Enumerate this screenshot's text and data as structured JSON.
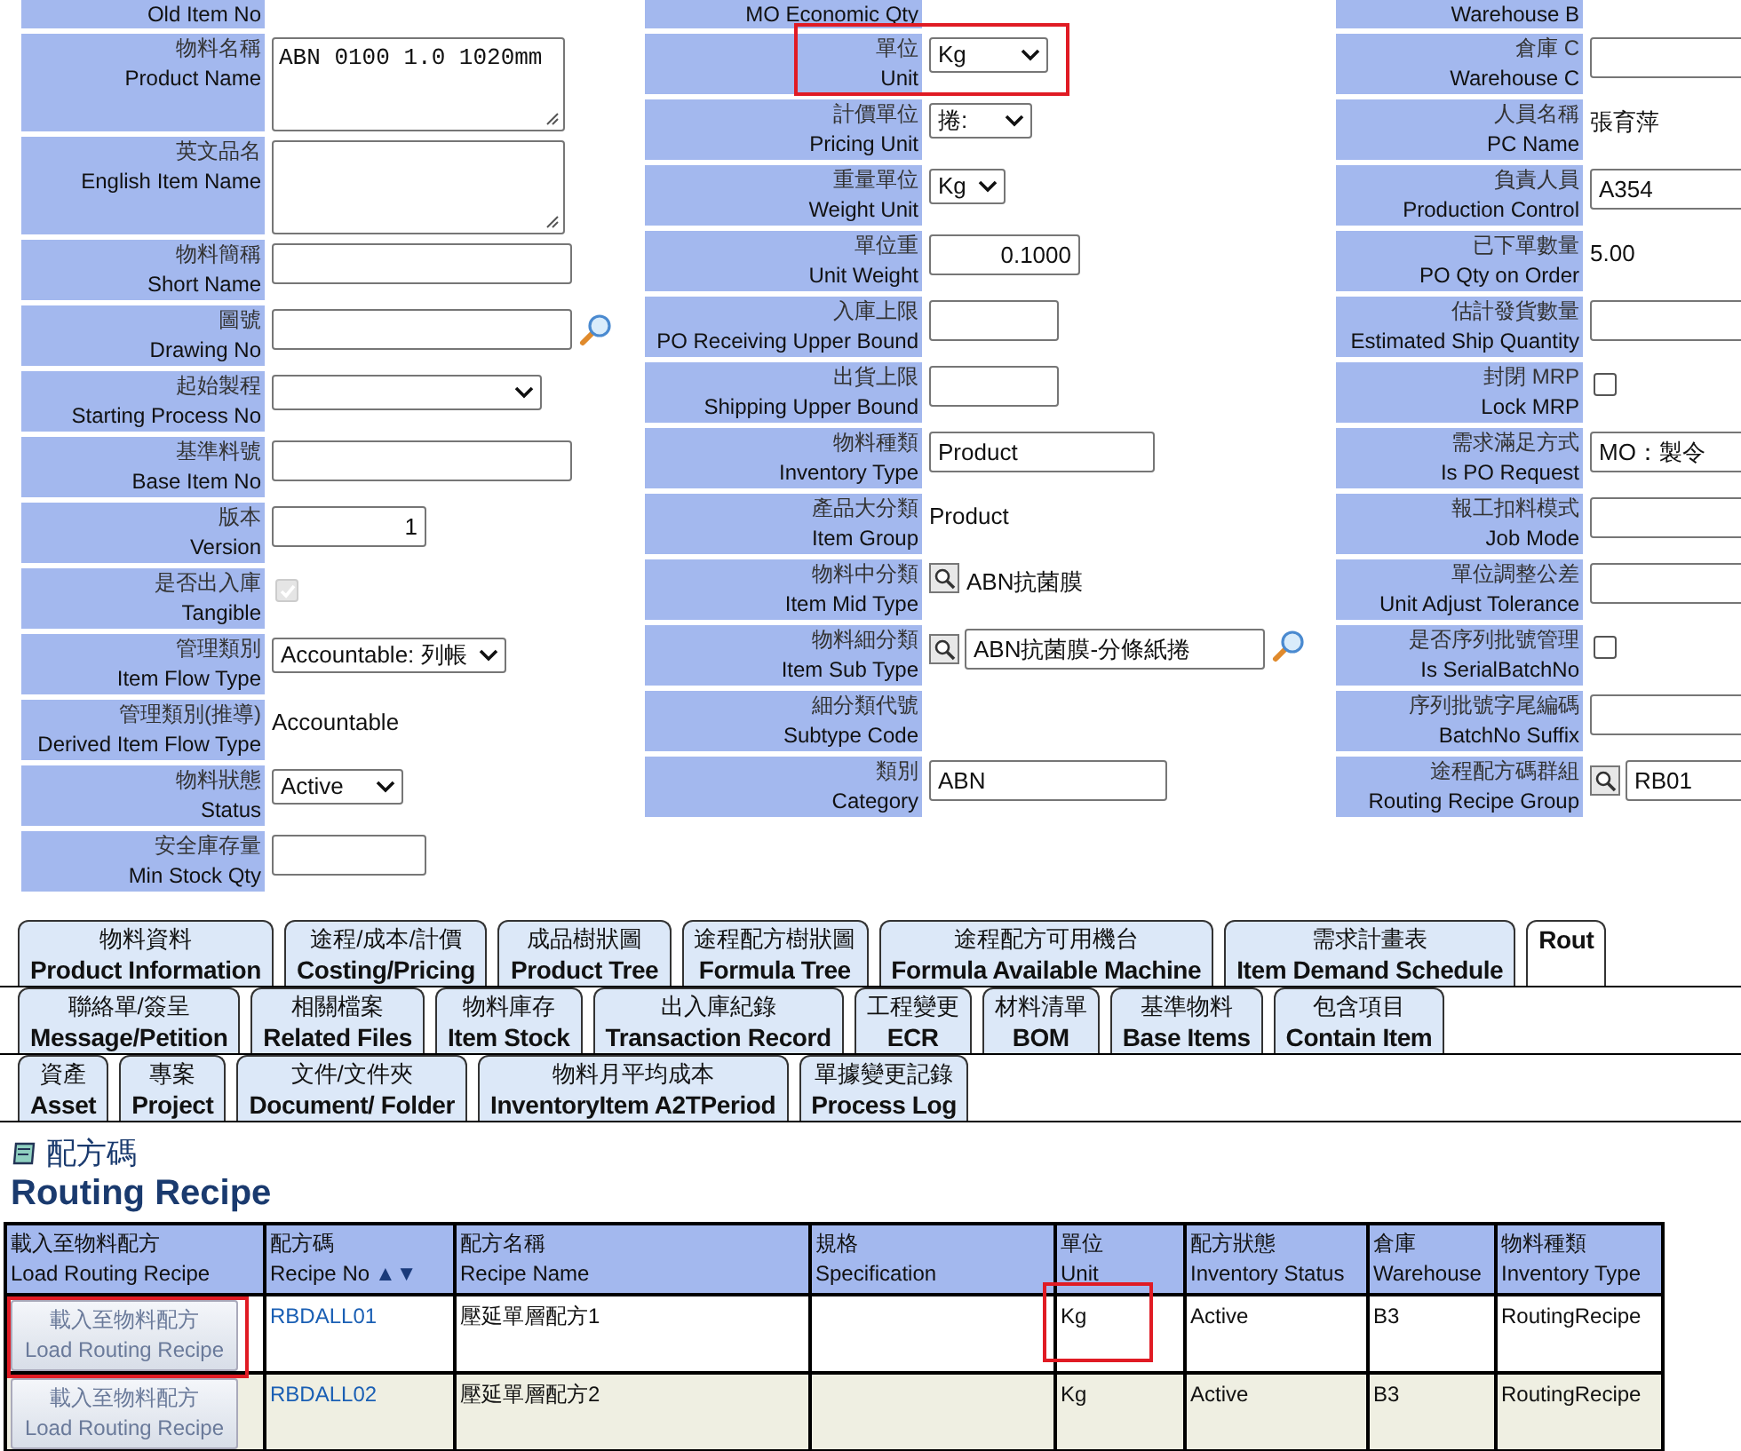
{
  "form_columns": [
    {
      "rows": [
        {
          "en": "Old Item No",
          "highlighted": false,
          "field": {
            "kind": "none"
          }
        },
        {
          "zh": "物料名稱",
          "en": "Product Name",
          "highlighted": false,
          "field": {
            "kind": "textarea",
            "value": "ABN 0100 1.0 1020mm"
          }
        },
        {
          "zh": "英文品名",
          "en": "English Item Name",
          "highlighted": false,
          "field": {
            "kind": "textarea"
          }
        },
        {
          "zh": "物料簡稱",
          "en": "Short Name",
          "highlighted": false,
          "field": {
            "kind": "input"
          }
        },
        {
          "zh": "圖號",
          "en": "Drawing No",
          "highlighted": false,
          "field": {
            "kind": "search_input"
          }
        },
        {
          "zh": "起始製程",
          "en": "Starting Process No",
          "highlighted": false,
          "field": {
            "kind": "select"
          }
        },
        {
          "zh": "基準料號",
          "en": "Base Item No",
          "highlighted": false,
          "field": {
            "kind": "input"
          }
        },
        {
          "zh": "版本",
          "en": "Version",
          "highlighted": false,
          "field": {
            "kind": "input",
            "value": "1"
          }
        },
        {
          "zh": "是否出入庫",
          "en": "Tangible",
          "highlighted": false,
          "field": {
            "kind": "checkbox",
            "checked": true,
            "disabled": true
          }
        },
        {
          "zh": "管理類別",
          "en": "Item Flow Type",
          "highlighted": false,
          "field": {
            "kind": "select",
            "value": "Accountable: 列帳"
          }
        },
        {
          "zh": "管理類別(推導)",
          "en": "Derived Item Flow Type",
          "highlighted": false,
          "field": {
            "kind": "text",
            "value": "Accountable"
          }
        },
        {
          "zh": "物料狀態",
          "en": "Status",
          "highlighted": false,
          "field": {
            "kind": "select",
            "value": "Active"
          }
        },
        {
          "zh": "安全庫存量",
          "en": "Min Stock Qty",
          "highlighted": false,
          "field": {
            "kind": "input"
          }
        }
      ]
    },
    {
      "rows": [
        {
          "en": "MO Economic Qty",
          "highlighted": false,
          "field": {
            "kind": "none"
          }
        },
        {
          "zh": "單位",
          "en": "Unit",
          "highlighted": true,
          "field": {
            "kind": "select",
            "value": "Kg"
          }
        },
        {
          "zh": "計價單位",
          "en": "Pricing Unit",
          "highlighted": false,
          "field": {
            "kind": "select",
            "value": "捲:"
          }
        },
        {
          "zh": "重量單位",
          "en": "Weight Unit",
          "highlighted": false,
          "field": {
            "kind": "select",
            "value": "Kg"
          }
        },
        {
          "zh": "單位重",
          "en": "Unit Weight",
          "highlighted": false,
          "field": {
            "kind": "input",
            "value": "0.1000"
          }
        },
        {
          "zh": "入庫上限",
          "en": "PO Receiving Upper Bound",
          "highlighted": false,
          "field": {
            "kind": "input"
          }
        },
        {
          "zh": "出貨上限",
          "en": "Shipping Upper Bound",
          "highlighted": false,
          "field": {
            "kind": "input"
          }
        },
        {
          "zh": "物料種類",
          "en": "Inventory Type",
          "highlighted": false,
          "field": {
            "kind": "input",
            "value": "Product"
          }
        },
        {
          "zh": "產品大分類",
          "en": "Item Group",
          "highlighted": false,
          "field": {
            "kind": "text",
            "value": "Product"
          }
        },
        {
          "zh": "物料中分類",
          "en": "Item Mid Type",
          "highlighted": false,
          "field": {
            "kind": "lookup_text",
            "value": "ABN抗菌膜"
          }
        },
        {
          "zh": "物料細分類",
          "en": "Item Sub Type",
          "highlighted": false,
          "field": {
            "kind": "lookup_input",
            "value": "ABN抗菌膜-分條紙捲"
          }
        },
        {
          "zh": "細分類代號",
          "en": "Subtype Code",
          "highlighted": false,
          "field": {
            "kind": "none"
          }
        },
        {
          "zh": "類別",
          "en": "Category",
          "highlighted": false,
          "field": {
            "kind": "input",
            "value": "ABN"
          }
        }
      ]
    },
    {
      "rows": [
        {
          "en": "Warehouse B",
          "highlighted": false,
          "field": {
            "kind": "none"
          }
        },
        {
          "zh": "倉庫 C",
          "en": "Warehouse C",
          "highlighted": false,
          "field": {
            "kind": "input"
          }
        },
        {
          "zh": "人員名稱",
          "en": "PC Name",
          "highlighted": false,
          "field": {
            "kind": "text",
            "value": "張育萍"
          }
        },
        {
          "zh": "負責人員",
          "en": "Production Control",
          "highlighted": false,
          "field": {
            "kind": "input",
            "value": "A354"
          }
        },
        {
          "zh": "已下單數量",
          "en": "PO Qty on Order",
          "highlighted": false,
          "field": {
            "kind": "text",
            "value": "5.00"
          }
        },
        {
          "zh": "估計發貨數量",
          "en": "Estimated Ship Quantity",
          "highlighted": false,
          "field": {
            "kind": "input"
          }
        },
        {
          "zh": "封閉 MRP",
          "en": "Lock MRP",
          "highlighted": false,
          "field": {
            "kind": "checkbox",
            "checked": false,
            "disabled": false
          }
        },
        {
          "zh": "需求滿足方式",
          "en": "Is PO Request",
          "highlighted": false,
          "field": {
            "kind": "input",
            "value": "MO：製令"
          }
        },
        {
          "zh": "報工扣料模式",
          "en": "Job Mode",
          "highlighted": false,
          "field": {
            "kind": "input"
          }
        },
        {
          "zh": "單位調整公差",
          "en": "Unit Adjust Tolerance",
          "highlighted": false,
          "field": {
            "kind": "input"
          }
        },
        {
          "zh": "是否序列批號管理",
          "en": "Is SerialBatchNo",
          "highlighted": false,
          "field": {
            "kind": "checkbox",
            "checked": false,
            "disabled": false
          }
        },
        {
          "zh": "序列批號字尾編碼",
          "en": "BatchNo Suffix",
          "highlighted": false,
          "field": {
            "kind": "input"
          }
        },
        {
          "zh": "途程配方碼群組",
          "en": "Routing Recipe Group",
          "highlighted": false,
          "field": {
            "kind": "lookup_input",
            "value": "RB01"
          }
        }
      ]
    }
  ],
  "tab_rows": [
    [
      {
        "zh": "物料資料",
        "en": "Product Information",
        "selected": false
      },
      {
        "zh": "途程/成本/計價",
        "en": "Costing/Pricing",
        "selected": false
      },
      {
        "zh": "成品樹狀圖",
        "en": "Product Tree",
        "selected": false
      },
      {
        "zh": "途程配方樹狀圖",
        "en": "Formula Tree",
        "selected": false
      },
      {
        "zh": "途程配方可用機台",
        "en": "Formula Available Machine",
        "selected": false
      },
      {
        "zh": "需求計畫表",
        "en": "Item Demand Schedule",
        "selected": false
      },
      {
        "en": "Rout",
        "selected": true
      }
    ],
    [
      {
        "zh": "聯絡單/簽呈",
        "en": "Message/Petition",
        "selected": false
      },
      {
        "zh": "相關檔案",
        "en": "Related Files",
        "selected": false
      },
      {
        "zh": "物料庫存",
        "en": "Item Stock",
        "selected": false
      },
      {
        "zh": "出入庫紀錄",
        "en": "Transaction Record",
        "selected": false
      },
      {
        "zh": "工程變更",
        "en": "ECR",
        "selected": false
      },
      {
        "zh": "材料清單",
        "en": "BOM",
        "selected": false
      },
      {
        "zh": "基準物料",
        "en": "Base Items",
        "selected": false
      },
      {
        "zh": "包含項目",
        "en": "Contain Item",
        "selected": false
      }
    ],
    [
      {
        "zh": "資產",
        "en": "Asset",
        "selected": false
      },
      {
        "zh": "專案",
        "en": "Project",
        "selected": false
      },
      {
        "zh": "文件/文件夾",
        "en": "Document/ Folder",
        "selected": false
      },
      {
        "zh": "物料月平均成本",
        "en": "InventoryItem A2TPeriod",
        "selected": false
      },
      {
        "zh": "單據變更記錄",
        "en": "Process Log",
        "selected": false
      }
    ]
  ],
  "section": {
    "title_zh": "配方碼",
    "title_en": "Routing Recipe"
  },
  "table": {
    "columns": [
      {
        "zh": "載入至物料配方",
        "en": "Load Routing Recipe"
      },
      {
        "zh": "配方碼",
        "en": "Recipe No",
        "sort": "▲▼"
      },
      {
        "zh": "配方名稱",
        "en": "Recipe Name"
      },
      {
        "zh": "規格",
        "en": "Specification"
      },
      {
        "zh": "單位",
        "en": "Unit"
      },
      {
        "zh": "配方狀態",
        "en": "Inventory Status"
      },
      {
        "zh": "倉庫",
        "en": "Warehouse"
      },
      {
        "zh": "物料種類",
        "en": "Inventory Type"
      }
    ],
    "rows": [
      {
        "cells": [
          {
            "kind": "button",
            "lines": [
              "載入至物料配方",
              "Load Routing Recipe"
            ],
            "highlighted": true
          },
          {
            "kind": "link",
            "text": "RBDALL01",
            "highlighted": false
          },
          {
            "kind": "text",
            "text": "壓延單層配方1",
            "highlighted": false
          },
          {
            "kind": "text",
            "highlighted": false
          },
          {
            "kind": "text",
            "text": "Kg",
            "highlighted": true
          },
          {
            "kind": "text",
            "text": "Active",
            "highlighted": false
          },
          {
            "kind": "text",
            "text": "B3",
            "highlighted": false
          },
          {
            "kind": "text",
            "text": "RoutingRecipe",
            "highlighted": false
          }
        ]
      },
      {
        "cells": [
          {
            "kind": "button",
            "lines": [
              "載入至物料配方",
              "Load Routing Recipe"
            ],
            "highlighted": false
          },
          {
            "kind": "link",
            "text": "RBDALL02",
            "highlighted": false
          },
          {
            "kind": "text",
            "text": "壓延單層配方2",
            "highlighted": false
          },
          {
            "kind": "text",
            "highlighted": false
          },
          {
            "kind": "text",
            "text": "Kg",
            "highlighted": false
          },
          {
            "kind": "text",
            "text": "Active",
            "highlighted": false
          },
          {
            "kind": "text",
            "text": "B3",
            "highlighted": false
          },
          {
            "kind": "text",
            "text": "RoutingRecipe",
            "highlighted": false
          }
        ]
      }
    ]
  }
}
